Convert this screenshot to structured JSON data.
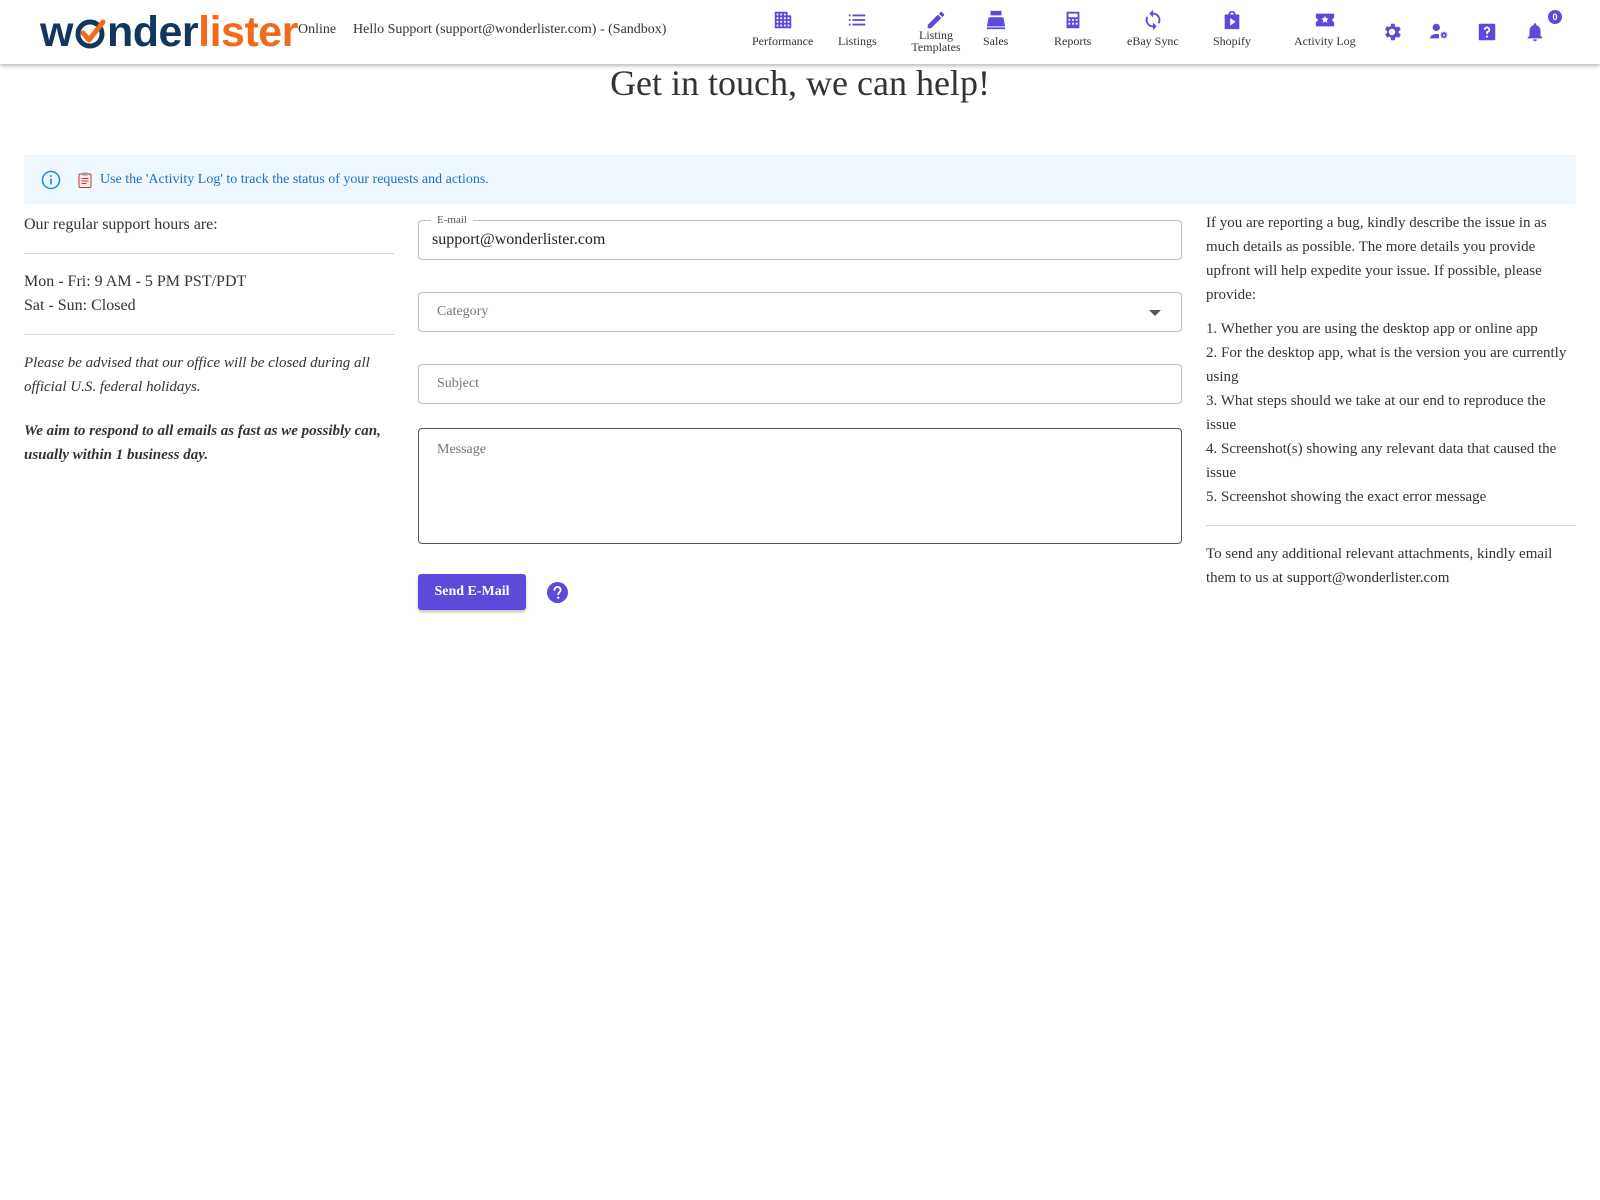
{
  "header": {
    "logo_part1": "w",
    "logo_part2": "nder",
    "logo_part3": "lister",
    "status": "Online",
    "greeting": "Hello Support (support@wonderlister.com) - (Sandbox)",
    "notification_count": "0",
    "nav": [
      {
        "label": "Performance",
        "icon": "building-icon"
      },
      {
        "label": "Listings",
        "icon": "list-icon"
      },
      {
        "label": "Listing Templates",
        "icon": "pencil-icon"
      },
      {
        "label": "Sales",
        "icon": "register-icon"
      },
      {
        "label": "Reports",
        "icon": "calculator-icon"
      },
      {
        "label": "eBay Sync",
        "icon": "sync-icon"
      },
      {
        "label": "Shopify",
        "icon": "shopify-bag-icon"
      },
      {
        "label": "Activity Log",
        "icon": "star-ticket-icon"
      }
    ],
    "tools": [
      "gear-icon",
      "user-settings-icon",
      "help-square-icon",
      "bell-icon"
    ]
  },
  "main": {
    "title": "Get in touch, we can help!",
    "info_text": "Use the 'Activity Log' to track the status of your requests and actions.",
    "support": {
      "heading": "Our regular support hours are:",
      "weekdays": "Mon - Fri: 9 AM - 5 PM PST/PDT",
      "weekend": "Sat - Sun: Closed",
      "holiday_note": "Please be advised that our office will be closed during all official U.S. federal holidays.",
      "response_note": "We aim to respond to all emails as fast as we possibly can, usually within 1 business day."
    },
    "form": {
      "email_label": "E-mail",
      "email_value": "support@wonderlister.com",
      "category_placeholder": "Category",
      "subject_placeholder": "Subject",
      "message_placeholder": "Message",
      "send_label": "Send E-Mail"
    },
    "bug_help": {
      "intro": "If you are reporting a bug, kindly describe the issue in as much details as possible. The more details you provide upfront will help expedite your issue. If possible, please provide:",
      "items": [
        "1. Whether you are using the desktop app or online app",
        "2. For the desktop app, what is the version you are currently using",
        "3. What steps should we take at our end to reproduce the issue",
        "4. Screenshot(s) showing any relevant data that caused the issue",
        "5. Screenshot showing the exact error message"
      ],
      "attachments": "To send any additional relevant attachments, kindly email them to us at support@wonderlister.com"
    }
  },
  "colors": {
    "accent": "#5b4bd8",
    "logo_navy": "#13365f",
    "logo_orange": "#f26a1b",
    "info_bg": "#eff8fe",
    "info_text": "#1572c6"
  }
}
